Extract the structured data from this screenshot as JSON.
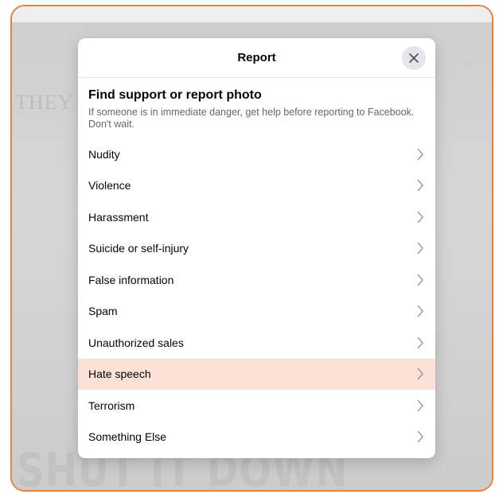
{
  "background": {
    "left_text": "THEY",
    "bottom_text": "SHUT IT DOWN"
  },
  "dialog": {
    "title": "Report",
    "close_icon": "close-icon",
    "heading": "Find support or report photo",
    "description": "If someone is in immediate danger, get help before reporting to Facebook. Don't wait.",
    "options": [
      {
        "label": "Nudity",
        "highlighted": false
      },
      {
        "label": "Violence",
        "highlighted": false
      },
      {
        "label": "Harassment",
        "highlighted": false
      },
      {
        "label": "Suicide or self-injury",
        "highlighted": false
      },
      {
        "label": "False information",
        "highlighted": false
      },
      {
        "label": "Spam",
        "highlighted": false
      },
      {
        "label": "Unauthorized sales",
        "highlighted": false
      },
      {
        "label": "Hate speech",
        "highlighted": true
      },
      {
        "label": "Terrorism",
        "highlighted": false
      },
      {
        "label": "Something Else",
        "highlighted": false
      }
    ],
    "chevron_icon": "chevron-right-icon"
  },
  "colors": {
    "frame_border": "#e8823e",
    "highlight": "#fbe1d6"
  }
}
